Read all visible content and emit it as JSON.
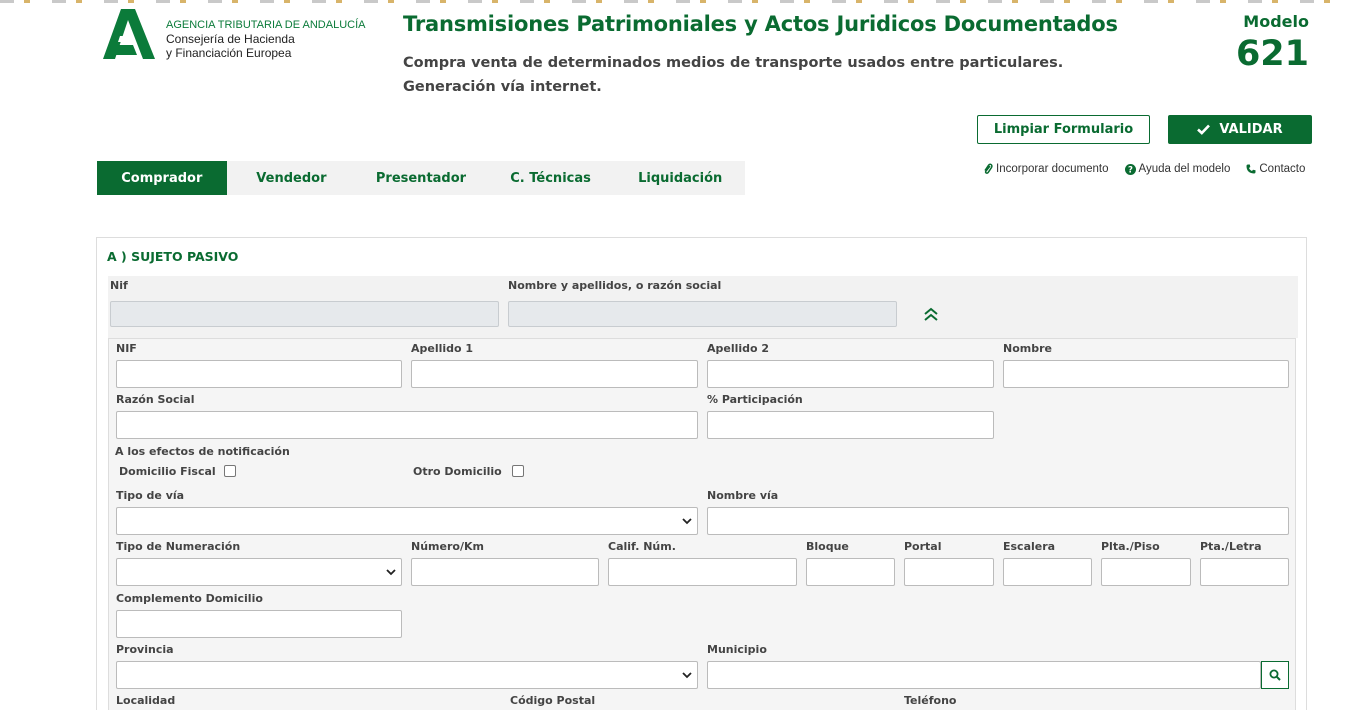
{
  "header": {
    "org_line1": "AGENCIA TRIBUTARIA DE ANDALUCÍA",
    "org_line2": "Consejería de Hacienda",
    "org_line3": "y Financiación Europea",
    "title": "Transmisiones Patrimoniales y Actos Juridicos Documentados",
    "subtitle": "Compra venta de determinados medios de transporte usados entre particulares. Generación vía internet.",
    "modelo_label": "Modelo",
    "modelo_number": "621"
  },
  "actions": {
    "clear_label": "Limpiar Formulario",
    "validate_label": "VALIDAR"
  },
  "links": {
    "incorporar": "Incorporar documento",
    "ayuda": "Ayuda del modelo",
    "contacto": "Contacto"
  },
  "tabs": [
    {
      "label": "Comprador",
      "active": true
    },
    {
      "label": "Vendedor",
      "active": false
    },
    {
      "label": "Presentador",
      "active": false
    },
    {
      "label": "C. Técnicas",
      "active": false
    },
    {
      "label": "Liquidación",
      "active": false
    }
  ],
  "section": {
    "title": "A ) SUJETO PASIVO",
    "summary": {
      "nif_label": "Nif",
      "name_label": "Nombre y apellidos, o razón social"
    },
    "fields": {
      "nif": "NIF",
      "apellido1": "Apellido 1",
      "apellido2": "Apellido 2",
      "nombre": "Nombre",
      "razon_social": "Razón Social",
      "participacion": "% Participación",
      "notificacion": "A los efectos de notificación",
      "domicilio_fiscal": "Domicilio Fiscal",
      "otro_domicilio": "Otro Domicilio",
      "tipo_via": "Tipo de vía",
      "nombre_via": "Nombre vía",
      "tipo_numeracion": "Tipo de Numeración",
      "numero_km": "Número/Km",
      "calif_num": "Calif. Núm.",
      "bloque": "Bloque",
      "portal": "Portal",
      "escalera": "Escalera",
      "plta_piso": "Plta./Piso",
      "pta_letra": "Pta./Letra",
      "complemento": "Complemento Domicilio",
      "provincia": "Provincia",
      "municipio": "Municipio",
      "localidad": "Localidad",
      "codigo_postal": "Código Postal",
      "telefono": "Teléfono"
    }
  },
  "colors": {
    "brand_green": "#0a6b31",
    "panel_gray": "#f2f2f2"
  },
  "icons": [
    "check-icon",
    "paperclip-icon",
    "question-circle-icon",
    "phone-icon",
    "double-chevron-up-icon",
    "chevron-down-icon",
    "search-icon"
  ]
}
